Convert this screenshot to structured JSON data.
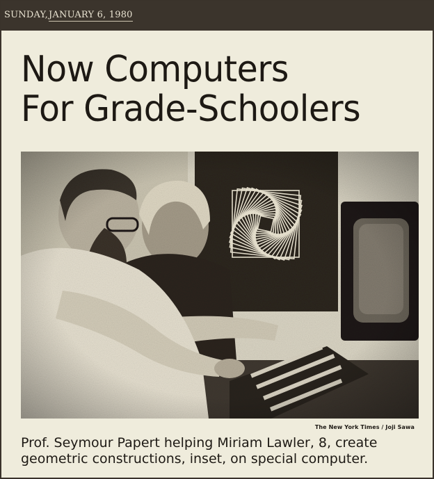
{
  "dateline": {
    "day": "SUNDAY,",
    "date": "JANUARY 6, 1980"
  },
  "article": {
    "headline_line1": "Now Computers",
    "headline_line2": "For Grade-Schoolers",
    "photo_credit": "The New York Times / Joji Sawa",
    "caption_line1": "Prof. Seymour Papert helping Miriam Lawler, 8, create",
    "caption_line2": "geometric constructions, inset, on special computer."
  },
  "colors": {
    "dateline_bg": "#3b342c",
    "paper": "#efecdc",
    "ink": "#1d1914"
  }
}
